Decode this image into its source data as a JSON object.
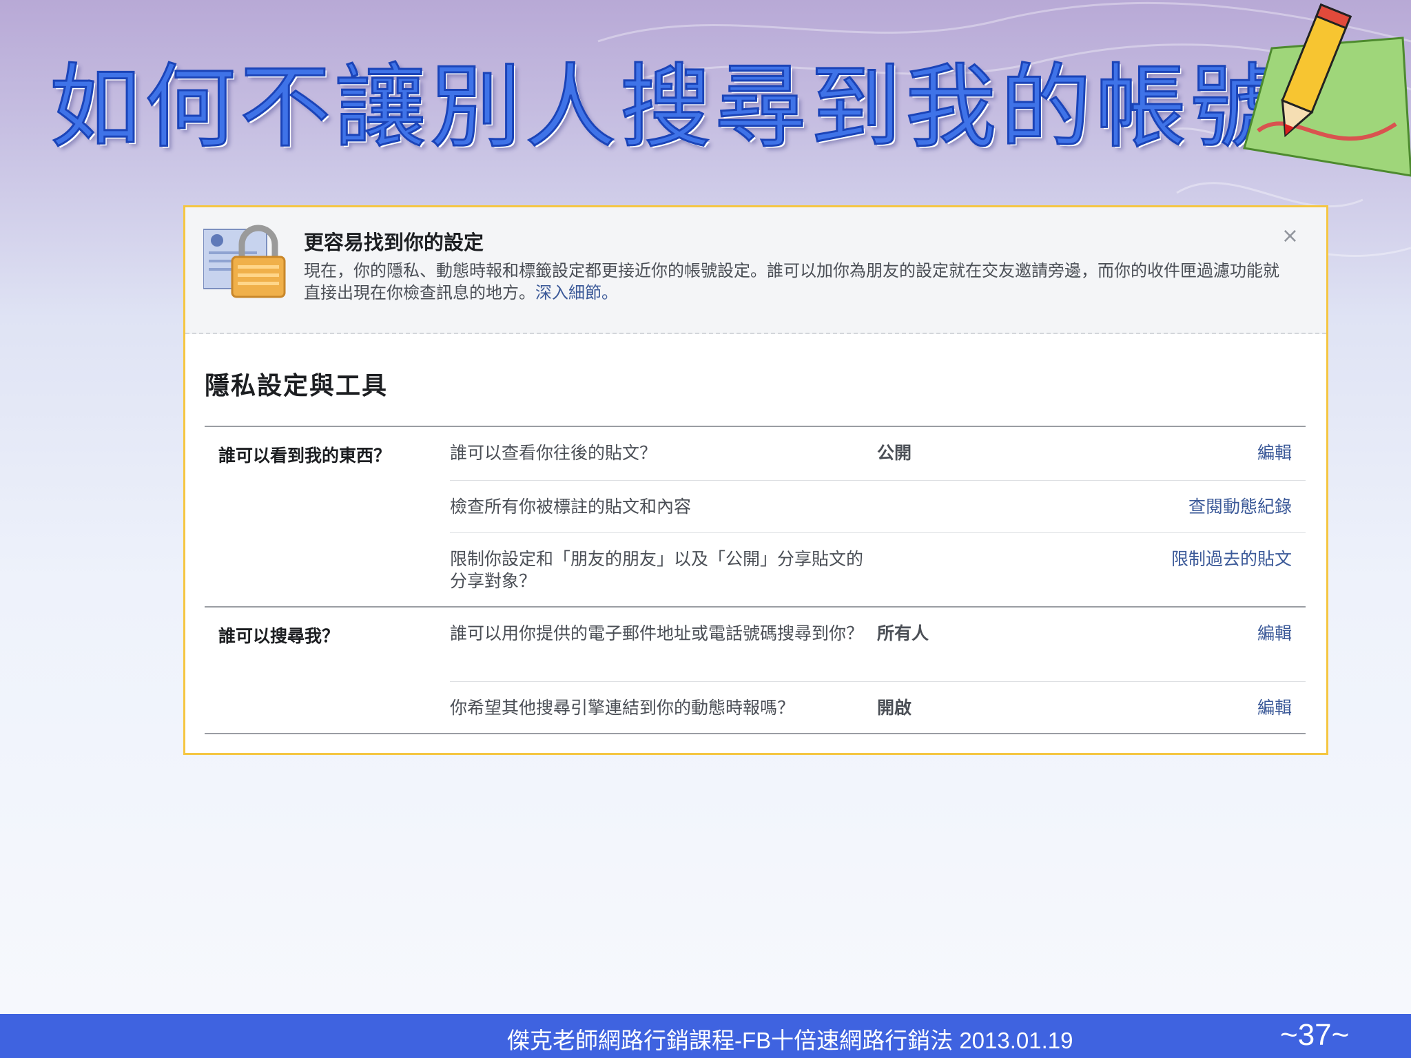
{
  "slide": {
    "title": "如何不讓別人搜尋到我的帳號?"
  },
  "notice": {
    "title": "更容易找到你的設定",
    "body": "現在，你的隱私、動態時報和標籤設定都更接近你的帳號設定。誰可以加你為朋友的設定就在交友邀請旁邊，而你的收件匣過濾功能就直接出現在你檢查訊息的地方。",
    "link": "深入細節。",
    "close": "×"
  },
  "section": {
    "title": "隱私設定與工具"
  },
  "groups": [
    {
      "label": "誰可以看到我的東西？",
      "rows": [
        {
          "question": "誰可以查看你往後的貼文？",
          "value": "公開",
          "action": "編輯"
        },
        {
          "question": "檢查所有你被標註的貼文和內容",
          "value": "",
          "action": "查閱動態紀錄"
        },
        {
          "question": "限制你設定和「朋友的朋友」以及「公開」分享貼文的分享對象？",
          "value": "",
          "action": "限制過去的貼文"
        }
      ]
    },
    {
      "label": "誰可以搜尋我？",
      "rows": [
        {
          "question": "誰可以用你提供的電子郵件地址或電話號碼搜尋到你？",
          "value": "所有人",
          "action": "編輯"
        },
        {
          "question": "你希望其他搜尋引擎連結到你的動態時報嗎？",
          "value": "開啟",
          "action": "編輯"
        }
      ]
    }
  ],
  "footer": {
    "text": "傑克老師網路行銷課程-FB十倍速網路行銷法 2013.01.19",
    "page": "~37~"
  },
  "colors": {
    "title_blue": "#3f73e8",
    "footer_blue": "#3f63e0",
    "panel_border": "#f5c642",
    "link_blue": "#3b5998"
  },
  "icons": {
    "lock": "lock-icon",
    "close": "close-icon",
    "pencil": "pencil-icon"
  }
}
